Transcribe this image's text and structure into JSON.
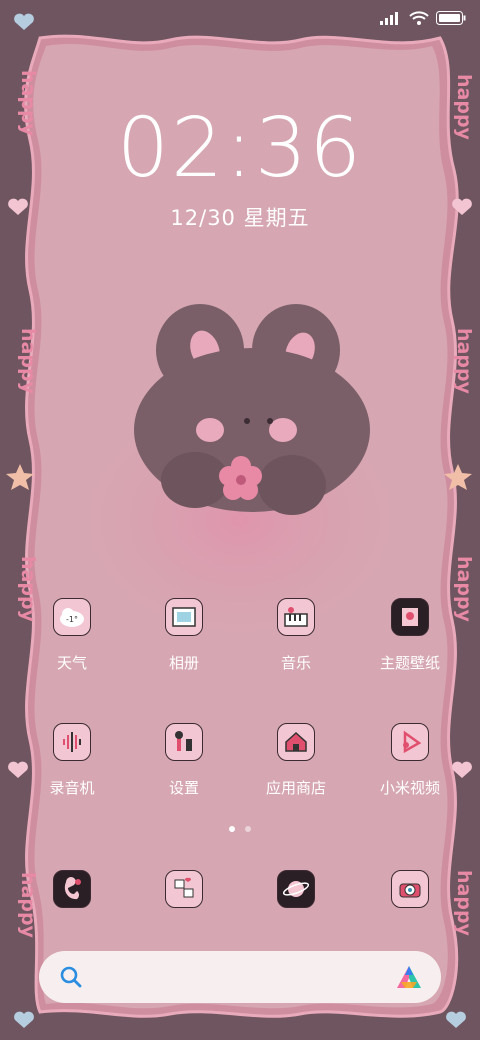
{
  "status_bar": {
    "signal": "signal-bars-icon",
    "wifi": "wifi-icon",
    "battery": "battery-icon"
  },
  "lock": {
    "time": "02:36",
    "date": "12/30 星期五"
  },
  "frame": {
    "side_text": "happy",
    "border_color": "#6e5560",
    "screen_color": "#d6a7b2",
    "accent": "#e88aa6"
  },
  "apps_row1": [
    {
      "label": "天气",
      "icon": "weather-icon",
      "temp": "-1°"
    },
    {
      "label": "相册",
      "icon": "gallery-icon"
    },
    {
      "label": "音乐",
      "icon": "music-icon"
    },
    {
      "label": "主题壁纸",
      "icon": "themes-icon"
    }
  ],
  "apps_row2": [
    {
      "label": "录音机",
      "icon": "recorder-icon"
    },
    {
      "label": "设置",
      "icon": "settings-icon"
    },
    {
      "label": "应用商店",
      "icon": "app-store-icon"
    },
    {
      "label": "小米视频",
      "icon": "video-icon"
    }
  ],
  "dock": [
    {
      "icon": "phone-icon"
    },
    {
      "icon": "messages-icon"
    },
    {
      "icon": "browser-icon"
    },
    {
      "icon": "camera-icon"
    }
  ],
  "page_indicator": {
    "pages": 2,
    "current": 1
  },
  "search_bar": {
    "search_icon": "search-icon",
    "assistant_icon": "assistant-logo-icon"
  }
}
